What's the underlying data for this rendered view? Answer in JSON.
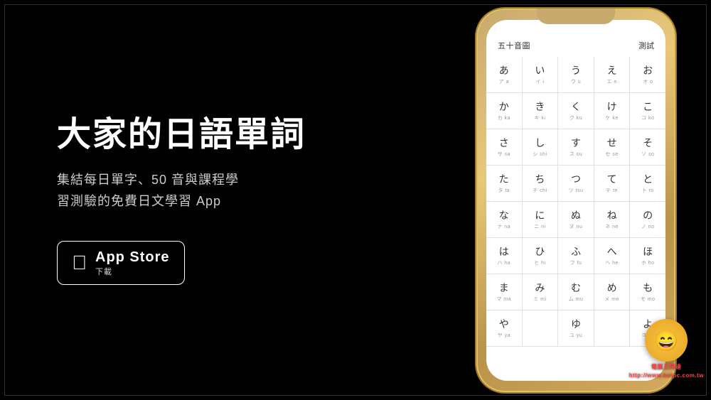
{
  "page": {
    "background": "#000"
  },
  "left": {
    "title": "大家的日語單詞",
    "subtitle_line1": "集結每日單字、50 音與課程學",
    "subtitle_line2": "習測驗的免費日文學習 App",
    "app_store_label": "App Store",
    "app_store_sub": "下載"
  },
  "phone": {
    "screen_title": "五十音圖",
    "screen_action": "測試",
    "rows": [
      [
        {
          "main": "あ",
          "sub": "ア a"
        },
        {
          "main": "い",
          "sub": "イ i"
        },
        {
          "main": "う",
          "sub": "ウ u"
        },
        {
          "main": "え",
          "sub": "エ e"
        },
        {
          "main": "お",
          "sub": "オ o"
        }
      ],
      [
        {
          "main": "か",
          "sub": "カ ka"
        },
        {
          "main": "き",
          "sub": "キ ki"
        },
        {
          "main": "く",
          "sub": "ク ku"
        },
        {
          "main": "け",
          "sub": "ケ ke"
        },
        {
          "main": "こ",
          "sub": "コ ko"
        }
      ],
      [
        {
          "main": "さ",
          "sub": "サ sa"
        },
        {
          "main": "し",
          "sub": "シ shi"
        },
        {
          "main": "す",
          "sub": "ス su"
        },
        {
          "main": "せ",
          "sub": "セ se"
        },
        {
          "main": "そ",
          "sub": "ソ so"
        }
      ],
      [
        {
          "main": "た",
          "sub": "タ ta"
        },
        {
          "main": "ち",
          "sub": "チ chi"
        },
        {
          "main": "つ",
          "sub": "ツ tsu"
        },
        {
          "main": "て",
          "sub": "テ te"
        },
        {
          "main": "と",
          "sub": "ト to"
        }
      ],
      [
        {
          "main": "な",
          "sub": "ナ na"
        },
        {
          "main": "に",
          "sub": "ニ ni"
        },
        {
          "main": "ぬ",
          "sub": "ヌ nu"
        },
        {
          "main": "ね",
          "sub": "ネ ne"
        },
        {
          "main": "の",
          "sub": "ノ no"
        }
      ],
      [
        {
          "main": "は",
          "sub": "ハ ha"
        },
        {
          "main": "ひ",
          "sub": "ヒ hi"
        },
        {
          "main": "ふ",
          "sub": "フ fu"
        },
        {
          "main": "へ",
          "sub": "ヘ he"
        },
        {
          "main": "ほ",
          "sub": "ホ ho"
        }
      ],
      [
        {
          "main": "ま",
          "sub": "マ ma"
        },
        {
          "main": "み",
          "sub": "ミ mi"
        },
        {
          "main": "む",
          "sub": "ム mu"
        },
        {
          "main": "め",
          "sub": "メ me"
        },
        {
          "main": "も",
          "sub": "モ mo"
        }
      ],
      [
        {
          "main": "や",
          "sub": "ヤ ya"
        },
        {
          "main": "",
          "sub": ""
        },
        {
          "main": "ゆ",
          "sub": "ユ yu"
        },
        {
          "main": "",
          "sub": ""
        },
        {
          "main": "よ",
          "sub": "ヨ yo"
        }
      ]
    ]
  },
  "watermark": {
    "emoji": "😄",
    "site": "http://www.kotpc.com.tw",
    "brand": "電腦王阿達"
  }
}
